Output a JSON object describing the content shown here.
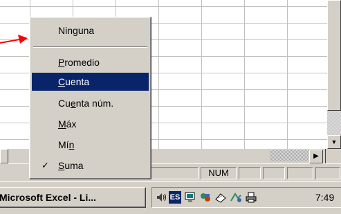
{
  "menu": {
    "items": [
      {
        "id": "ninguna",
        "pre": "Nin",
        "key": "g",
        "post": "una",
        "checked": false,
        "highlighted": false
      },
      {
        "id": "promedio",
        "pre": "",
        "key": "P",
        "post": "romedio",
        "checked": false,
        "highlighted": false
      },
      {
        "id": "cuenta",
        "pre": "",
        "key": "C",
        "post": "uenta",
        "checked": false,
        "highlighted": true
      },
      {
        "id": "cuenta-num",
        "pre": "Cu",
        "key": "e",
        "post": "nta núm.",
        "checked": false,
        "highlighted": false
      },
      {
        "id": "max",
        "pre": "",
        "key": "M",
        "post": "áx",
        "checked": false,
        "highlighted": false
      },
      {
        "id": "min",
        "pre": "Mí",
        "key": "n",
        "post": "",
        "checked": false,
        "highlighted": false
      },
      {
        "id": "suma",
        "pre": "",
        "key": "S",
        "post": "uma",
        "checked": true,
        "highlighted": false
      }
    ],
    "check_mark": "✓"
  },
  "statusbar": {
    "num_indicator": "NUM"
  },
  "taskbar": {
    "task_button_label": "Microsoft Excel - Li...",
    "clock": "7:49",
    "language_indicator": "ES",
    "tray_icons": [
      "speaker-icon",
      "language-icon",
      "monitor-icon",
      "network-icon",
      "scanner-icon",
      "connection-icon",
      "printer-icon"
    ]
  },
  "colors": {
    "menu_highlight": "#0a246a",
    "arrow": "#ff0000",
    "face": "#d4d0c8"
  }
}
